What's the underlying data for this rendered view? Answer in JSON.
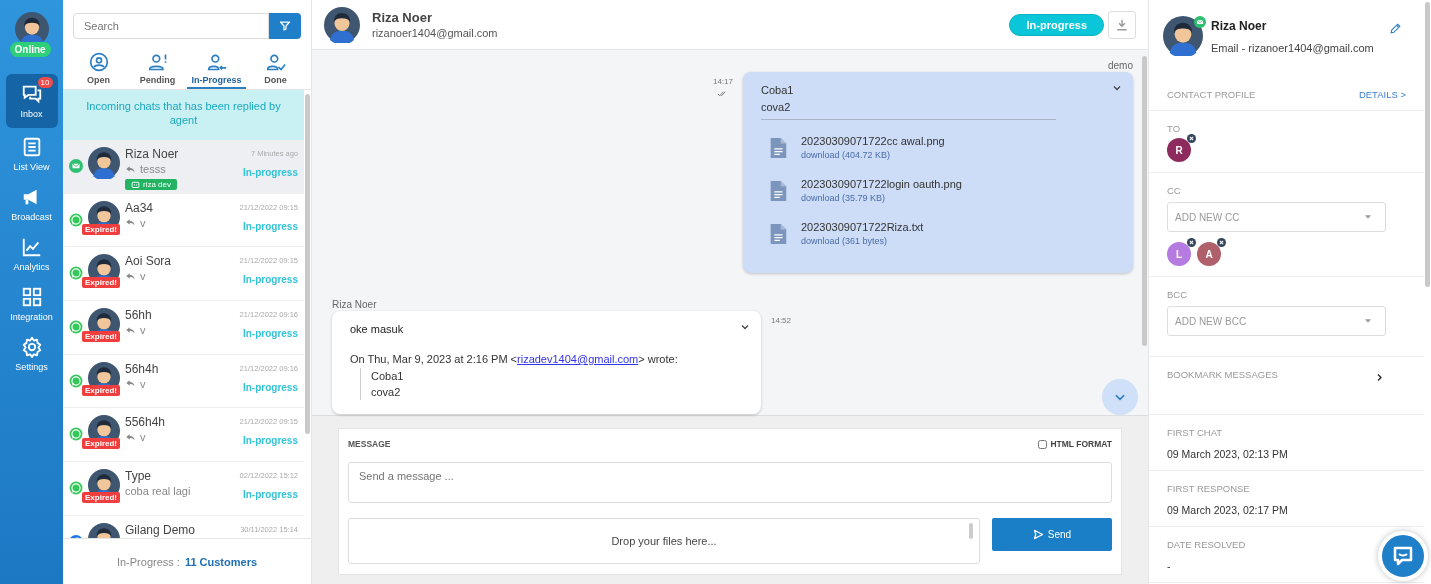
{
  "user": {
    "status": "Online"
  },
  "nav": [
    {
      "label": "Inbox",
      "selected": true,
      "badge": "10"
    },
    {
      "label": "List View",
      "selected": false
    },
    {
      "label": "Broadcast",
      "selected": false
    },
    {
      "label": "Analytics",
      "selected": false
    },
    {
      "label": "Integration",
      "selected": false
    },
    {
      "label": "Settings",
      "selected": false
    }
  ],
  "list": {
    "search": {
      "placeholder": "Search"
    },
    "tabs": [
      {
        "label": "Open",
        "selected": false
      },
      {
        "label": "Pending",
        "selected": false
      },
      {
        "label": "In-Progress",
        "selected": true
      },
      {
        "label": "Done",
        "selected": false
      }
    ],
    "banner": "Incoming chats that has been replied by agent",
    "conversations": [
      {
        "name": "Riza Noer",
        "preview": "tesss",
        "replied": true,
        "time": "7 Minutes ago",
        "status": "In-progress",
        "kind": "email",
        "agent": "riza dev",
        "selected": true
      },
      {
        "name": "Aa34",
        "preview": "v",
        "replied": true,
        "time": "21/12/2022 09:15",
        "status": "In-progress",
        "kind": "whatsapp",
        "badge": "Expired!",
        "selected": false
      },
      {
        "name": "Aoi Sora",
        "preview": "v",
        "replied": true,
        "time": "21/12/2022 09:15",
        "status": "In-progress",
        "kind": "whatsapp",
        "badge": "Expired!",
        "selected": false
      },
      {
        "name": "56hh",
        "preview": "v",
        "replied": true,
        "time": "21/12/2022 09:16",
        "status": "In-progress",
        "kind": "whatsapp",
        "badge": "Expired!",
        "selected": false
      },
      {
        "name": "56h4h",
        "preview": "v",
        "replied": true,
        "time": "21/12/2022 09:16",
        "status": "In-progress",
        "kind": "whatsapp",
        "badge": "Expired!",
        "selected": false
      },
      {
        "name": "556h4h",
        "preview": "v",
        "replied": true,
        "time": "21/12/2022 09:15",
        "status": "In-progress",
        "kind": "whatsapp",
        "badge": "Expired!",
        "selected": false
      },
      {
        "name": "Type",
        "preview": "coba real lagi",
        "replied": false,
        "time": "02/12/2022 15:12",
        "status": "In-progress",
        "kind": "whatsapp",
        "badge": "Expired!",
        "selected": false
      },
      {
        "name": "Gilang Demo",
        "time": "30/11/2022 15:14",
        "kind": "facebook",
        "selected": false
      }
    ],
    "footer": {
      "label": "In-Progress :",
      "count": "11 Customers"
    }
  },
  "chat": {
    "header": {
      "name": "Riza Noer",
      "email": "rizanoer1404@gmail.com",
      "status": "In-progress"
    },
    "messages": [
      {
        "kind": "outgoing",
        "sender": "demo",
        "time": "14:17",
        "lines": [
          "Coba1",
          "cova2"
        ],
        "files": [
          {
            "name": "20230309071722cc awal.png",
            "link": "download (404.72 KB)"
          },
          {
            "name": "20230309071722login oauth.png",
            "link": "download (35.79 KB)"
          },
          {
            "name": "20230309071722Riza.txt",
            "link": "download (361 bytes)"
          }
        ]
      },
      {
        "kind": "incoming",
        "sender": "Riza Noer",
        "time": "14:52",
        "text": "oke masuk",
        "quote": {
          "before": "On Thu, Mar 9, 2023 at 2:16 PM <",
          "link": "rizadev1404@gmail.com",
          "after": "> wrote:",
          "lines": [
            "Coba1",
            "cova2"
          ]
        }
      }
    ],
    "composer": {
      "label": "MESSAGE",
      "html_format": {
        "label": "HTML FORMAT",
        "checked": false
      },
      "placeholder": "Send a message ...",
      "dropzone": "Drop your files here...",
      "send": "Send"
    }
  },
  "contact": {
    "name": "Riza Noer",
    "email": "Email - rizanoer1404@gmail.com",
    "profile_label": "CONTACT PROFILE",
    "details": "DETAILS >",
    "to": {
      "label": "TO",
      "recipients": [
        {
          "initial": "R",
          "color": "#8e2b5e"
        }
      ]
    },
    "cc": {
      "label": "CC",
      "placeholder": "ADD NEW CC",
      "recipients": [
        {
          "initial": "L",
          "color": "#b57be0"
        },
        {
          "initial": "A",
          "color": "#b0606a"
        }
      ]
    },
    "bcc": {
      "label": "BCC",
      "placeholder": "ADD NEW BCC"
    },
    "bookmark": "BOOKMARK MESSAGES",
    "fields": [
      {
        "label": "FIRST CHAT",
        "value": "09 March 2023, 02:13 PM"
      },
      {
        "label": "FIRST RESPONSE",
        "value": "09 March 2023, 02:17 PM"
      },
      {
        "label": "DATE RESOLVED",
        "value": "-"
      }
    ]
  }
}
